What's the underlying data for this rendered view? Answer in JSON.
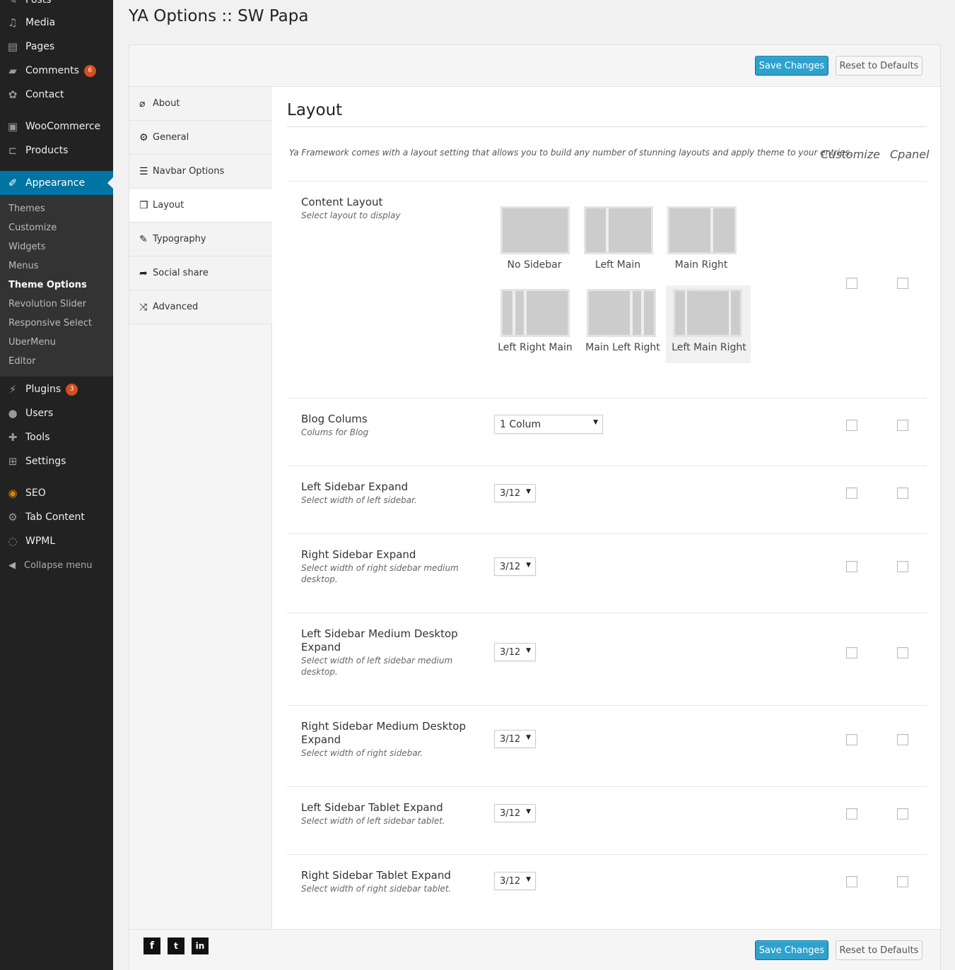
{
  "admin_menu": {
    "posts_partial": "Posts",
    "items": [
      {
        "label": "Media",
        "icon": "media-icon"
      },
      {
        "label": "Pages",
        "icon": "pages-icon"
      },
      {
        "label": "Comments",
        "icon": "comments-icon",
        "badge": "6"
      },
      {
        "label": "Contact",
        "icon": "contact-icon"
      },
      {
        "label": "WooCommerce",
        "icon": "woocommerce-icon"
      },
      {
        "label": "Products",
        "icon": "products-icon"
      },
      {
        "label": "Appearance",
        "icon": "appearance-icon"
      },
      {
        "label": "Plugins",
        "icon": "plugins-icon",
        "badge": "3"
      },
      {
        "label": "Users",
        "icon": "users-icon"
      },
      {
        "label": "Tools",
        "icon": "tools-icon"
      },
      {
        "label": "Settings",
        "icon": "settings-icon"
      },
      {
        "label": "SEO",
        "icon": "seo-icon"
      },
      {
        "label": "Tab Content",
        "icon": "gear-icon"
      },
      {
        "label": "WPML",
        "icon": "wpml-icon"
      }
    ],
    "appearance_submenu": [
      "Themes",
      "Customize",
      "Widgets",
      "Menus",
      "Theme Options",
      "Revolution Slider",
      "Responsive Select",
      "UberMenu",
      "Editor"
    ],
    "collapse_label": "Collapse menu"
  },
  "page": {
    "title": "YA Options :: SW Papa",
    "save_label": "Save Changes",
    "reset_label": "Reset to Defaults"
  },
  "tabs": [
    {
      "label": "About",
      "icon": "paperclip-icon"
    },
    {
      "label": "General",
      "icon": "gear-icon"
    },
    {
      "label": "Navbar Options",
      "icon": "bars-icon"
    },
    {
      "label": "Layout",
      "icon": "files-icon"
    },
    {
      "label": "Typography",
      "icon": "edit-icon"
    },
    {
      "label": "Social share",
      "icon": "share-icon"
    },
    {
      "label": "Advanced",
      "icon": "shuffle-icon"
    }
  ],
  "section": {
    "title": "Layout",
    "description": "Ya Framework comes with a layout setting that allows you to build any number of stunning layouts and apply theme to your entries.",
    "col_customize": "Customize",
    "col_cpanel": "Cpanel"
  },
  "content_layout": {
    "title": "Content Layout",
    "desc": "Select layout to display",
    "options": [
      "No Sidebar",
      "Left Main",
      "Main Right",
      "Left Right Main",
      "Main Left Right",
      "Left Main Right"
    ],
    "selected": "Left Main Right"
  },
  "blog": {
    "title": "Blog Colums",
    "desc": "Colums for Blog",
    "value": "1 Colum"
  },
  "rows": [
    {
      "title": "Left Sidebar Expand",
      "desc": "Select width of left sidebar.",
      "value": "3/12"
    },
    {
      "title": "Right Sidebar Expand",
      "desc": "Select width of right sidebar medium desktop.",
      "value": "3/12"
    },
    {
      "title": "Left Sidebar Medium Desktop Expand",
      "desc": "Select width of left sidebar medium desktop.",
      "value": "3/12"
    },
    {
      "title": "Right Sidebar Medium Desktop Expand",
      "desc": "Select width of right sidebar.",
      "value": "3/12"
    },
    {
      "title": "Left Sidebar Tablet Expand",
      "desc": "Select width of left sidebar tablet.",
      "value": "3/12"
    },
    {
      "title": "Right Sidebar Tablet Expand",
      "desc": "Select width of right sidebar tablet.",
      "value": "3/12"
    }
  ],
  "footer": {
    "social": [
      {
        "glyph": "f",
        "icon": "facebook-icon"
      },
      {
        "glyph": "t",
        "icon": "twitter-icon"
      },
      {
        "glyph": "in",
        "icon": "linkedin-icon"
      }
    ]
  },
  "colors": {
    "admin_bg": "#222222",
    "accent": "#0074a2",
    "button_primary": "#2ea2cc",
    "badge": "#d54e21"
  }
}
